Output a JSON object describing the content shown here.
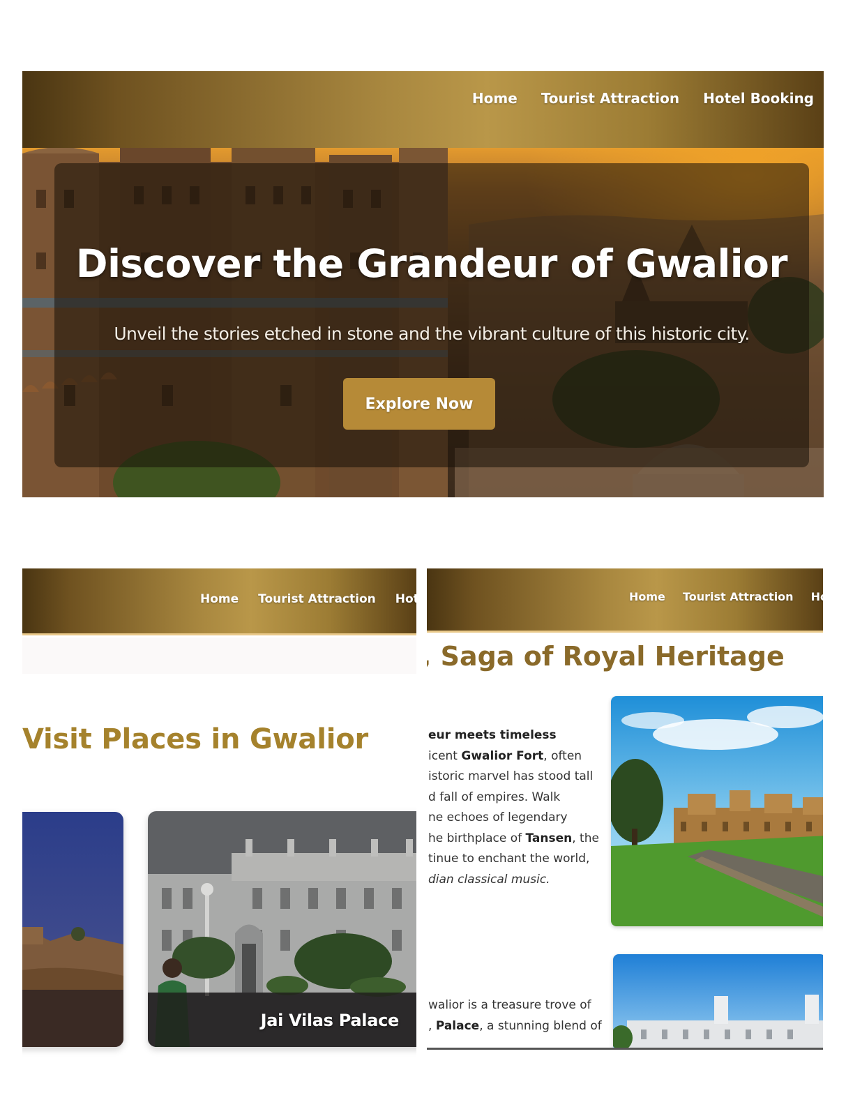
{
  "nav": {
    "home": "Home",
    "attractions": "Tourist Attraction",
    "hotels": "Hotel Booking",
    "hotels_cut_panel2": "Hotel",
    "hotels_cut_panel3": "Hote"
  },
  "hero": {
    "title": "Discover the Grandeur of Gwalior",
    "subtitle": "Unveil the stories etched in stone and the vibrant culture of this historic city.",
    "cta": "Explore Now"
  },
  "places": {
    "heading": "Visit Places in Gwalior",
    "cards": [
      {
        "label": ""
      },
      {
        "label": "Jai Vilas Palace"
      }
    ]
  },
  "heritage": {
    "heading": ", Saga of Royal Heritage",
    "para1": {
      "line1": "eur meets timeless",
      "line2_pre": "icent ",
      "line2_bold": "Gwalior Fort",
      "line2_post": ", often",
      "line3": "istoric marvel has stood tall",
      "line4": "d fall of empires. Walk",
      "line5": "ne echoes of legendary",
      "line6_pre": "he birthplace of ",
      "line6_bold": "Tansen",
      "line6_post": ", the",
      "line7": "tinue to enchant the world,",
      "line8": "dian classical music."
    },
    "para2": {
      "line1": "walior is a treasure trove of",
      "line2_pre": ", ",
      "line2_bold": "Palace",
      "line2_post": ", a stunning blend of"
    }
  },
  "colors": {
    "accent_gold": "#a5822c",
    "heading_brown": "#8a6a2a",
    "button_gold": "#b68a37",
    "nav_gradient_mid": "#b99749"
  },
  "icons": []
}
